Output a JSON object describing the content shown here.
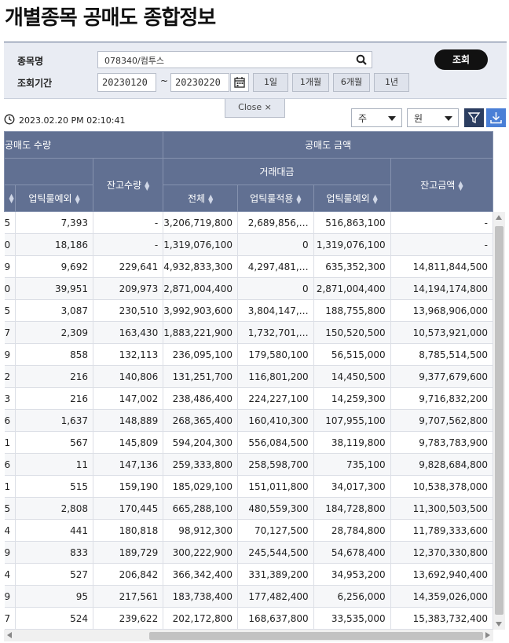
{
  "page": {
    "title": "개별종목 공매도 종합정보"
  },
  "search": {
    "stock_label": "종목명",
    "stock_value": "078340/컴투스",
    "period_label": "조회기간",
    "date_from": "20230120",
    "date_sep": "~",
    "date_to": "20230220",
    "query_button": "조회",
    "periods": [
      "1일",
      "1개월",
      "6개월",
      "1년"
    ],
    "close_label": "Close ×"
  },
  "toolbar": {
    "timestamp": "2023.02.20 PM 02:10:41",
    "unit_select": "주",
    "currency_select": "원"
  },
  "table": {
    "group_headers": {
      "qty": "공매도 수량",
      "amount": "공매도 금액",
      "trade_value": "거래대금"
    },
    "col_headers": [
      "",
      "업틱룰예외",
      "잔고수량",
      "전체",
      "업틱룰적용",
      "업틱룰예외",
      "잔고금액"
    ],
    "rows": [
      [
        "5",
        "7,393",
        "-",
        "3,206,719,800",
        "2,689,856,…",
        "516,863,100",
        "-"
      ],
      [
        "0",
        "18,186",
        "-",
        "1,319,076,100",
        "0",
        "1,319,076,100",
        "-"
      ],
      [
        "9",
        "9,692",
        "229,641",
        "4,932,833,300",
        "4,297,481,…",
        "635,352,300",
        "14,811,844,500"
      ],
      [
        "0",
        "39,951",
        "209,973",
        "2,871,004,400",
        "0",
        "2,871,004,400",
        "14,194,174,800"
      ],
      [
        "5",
        "3,087",
        "230,510",
        "3,992,903,600",
        "3,804,147,…",
        "188,755,800",
        "13,968,906,000"
      ],
      [
        "7",
        "2,309",
        "163,430",
        "1,883,221,900",
        "1,732,701,…",
        "150,520,500",
        "10,573,921,000"
      ],
      [
        "9",
        "858",
        "132,113",
        "236,095,100",
        "179,580,100",
        "56,515,000",
        "8,785,514,500"
      ],
      [
        "2",
        "216",
        "140,806",
        "131,251,700",
        "116,801,200",
        "14,450,500",
        "9,377,679,600"
      ],
      [
        "3",
        "216",
        "147,002",
        "238,486,400",
        "224,227,100",
        "14,259,300",
        "9,716,832,200"
      ],
      [
        "6",
        "1,637",
        "148,889",
        "268,365,400",
        "160,410,300",
        "107,955,100",
        "9,707,562,800"
      ],
      [
        "1",
        "567",
        "145,809",
        "594,204,300",
        "556,084,500",
        "38,119,800",
        "9,783,783,900"
      ],
      [
        "6",
        "11",
        "147,136",
        "259,333,800",
        "258,598,700",
        "735,100",
        "9,828,684,800"
      ],
      [
        "1",
        "515",
        "159,190",
        "185,029,100",
        "151,011,800",
        "34,017,300",
        "10,538,378,000"
      ],
      [
        "5",
        "2,808",
        "170,445",
        "665,288,100",
        "480,559,300",
        "184,728,800",
        "11,300,503,500"
      ],
      [
        "4",
        "441",
        "180,818",
        "98,912,300",
        "70,127,500",
        "28,784,800",
        "11,789,333,600"
      ],
      [
        "9",
        "833",
        "189,729",
        "300,222,900",
        "245,544,500",
        "54,678,400",
        "12,370,330,800"
      ],
      [
        "4",
        "527",
        "206,842",
        "366,342,400",
        "331,389,200",
        "34,953,200",
        "13,692,940,400"
      ],
      [
        "9",
        "95",
        "217,561",
        "183,738,400",
        "177,482,400",
        "6,256,000",
        "14,359,026,000"
      ],
      [
        "7",
        "524",
        "239,622",
        "202,172,800",
        "168,637,800",
        "33,535,000",
        "15,383,732,400"
      ]
    ]
  }
}
